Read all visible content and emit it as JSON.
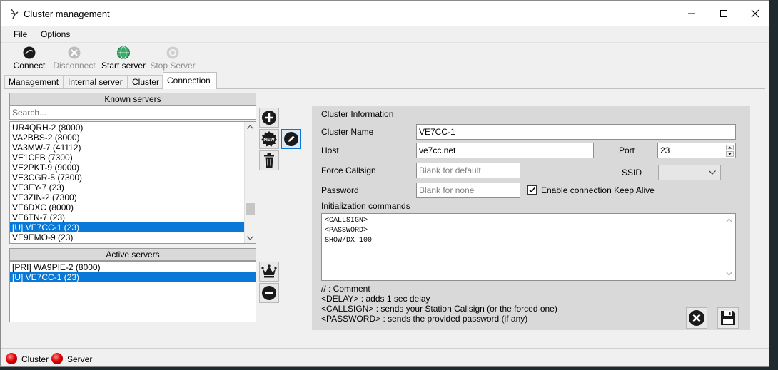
{
  "window": {
    "title": "Cluster management"
  },
  "menu": [
    "File",
    "Options"
  ],
  "toolbar": {
    "connect": "Connect",
    "disconnect": "Disconnect",
    "start_server": "Start server",
    "stop_server": "Stop Server"
  },
  "tabs": [
    "Management",
    "Internal server",
    "Cluster",
    "Connection"
  ],
  "known_servers": {
    "header": "Known servers",
    "search_placeholder": "Search...",
    "items": [
      "UR4QRH-2 (8000)",
      "VA2BBS-2 (8000)",
      "VA3MW-7 (41112)",
      "VE1CFB (7300)",
      "VE2PKT-9 (9000)",
      "VE3CGR-5 (7300)",
      "VE3EY-7 (23)",
      "VE3ZIN-2 (7300)",
      "VE6DXC (8000)",
      "VE6TN-7 (23)",
      "[U] VE7CC-1 (23)",
      "VE9EMO-9 (23)"
    ],
    "selected": "[U] VE7CC-1 (23)"
  },
  "active_servers": {
    "header": "Active servers",
    "items": [
      "[PRI] WA9PIE-2 (8000)",
      "[U] VE7CC-1 (23)"
    ],
    "selected": "[U] VE7CC-1 (23)"
  },
  "cluster_info": {
    "header": "Cluster Information",
    "name_label": "Cluster Name",
    "name_value": "VE7CC-1",
    "host_label": "Host",
    "host_value": "ve7cc.net",
    "port_label": "Port",
    "port_value": "23",
    "force_callsign_label": "Force Callsign",
    "force_callsign_placeholder": "Blank for default",
    "ssid_label": "SSID",
    "password_label": "Password",
    "password_placeholder": "Blank for none",
    "keepalive_label": "Enable connection Keep Alive",
    "keepalive_checked": true,
    "init_label": "Initialization commands",
    "init_lines": [
      "<CALLSIGN>",
      "<PASSWORD>",
      "SHOW/DX 100"
    ],
    "hints": [
      "// : Comment",
      "<DELAY> : adds 1 sec delay",
      "<CALLSIGN> : sends your Station Callsign (or the forced one)",
      "<PASSWORD> : sends the provided password (if any)"
    ]
  },
  "status": {
    "cluster": "Cluster",
    "server": "Server"
  },
  "colors": {
    "selection": "#0a78d7",
    "panel": "#d9d9d9",
    "led": "#e00000"
  }
}
